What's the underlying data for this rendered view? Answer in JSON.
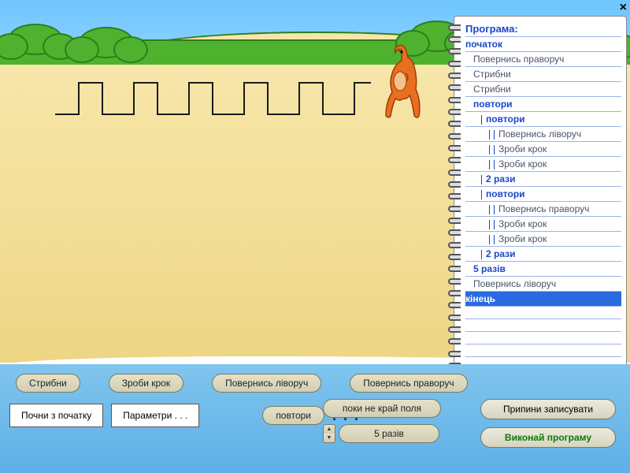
{
  "close_label": "×",
  "buttons": {
    "jump": "Стрибни",
    "step": "Зроби крок",
    "turn_left": "Повернись ліворуч",
    "turn_right": "Повернись праворуч",
    "start_over": "Почни з початку",
    "params": "Параметри . . .",
    "repeat": "повтори",
    "while_not_edge": "поки не край поля",
    "times_5": "5 разів",
    "stop_record": "Припини записувати",
    "run": "Виконай програму"
  },
  "ellipsis": ". . .",
  "program": {
    "title": "Програма:",
    "lines": [
      {
        "text": "початок",
        "cls": "kw",
        "indent": 0
      },
      {
        "text": "Повернись праворуч",
        "cls": "cmd",
        "indent": 1
      },
      {
        "text": "Стрибни",
        "cls": "cmd",
        "indent": 1
      },
      {
        "text": "Стрибни",
        "cls": "cmd",
        "indent": 1
      },
      {
        "text": "повтори",
        "cls": "kw",
        "indent": 1
      },
      {
        "text": "повтори",
        "cls": "kw",
        "indent": 2,
        "bars": 1
      },
      {
        "text": "Повернись ліворуч",
        "cls": "cmd",
        "indent": 3,
        "bars": 2
      },
      {
        "text": "Зроби крок",
        "cls": "cmd",
        "indent": 3,
        "bars": 2
      },
      {
        "text": "Зроби крок",
        "cls": "cmd",
        "indent": 3,
        "bars": 2
      },
      {
        "text": "2 рази",
        "cls": "kw",
        "indent": 2,
        "bars": 1
      },
      {
        "text": "повтори",
        "cls": "kw",
        "indent": 2,
        "bars": 1
      },
      {
        "text": "Повернись праворуч",
        "cls": "cmd",
        "indent": 3,
        "bars": 2
      },
      {
        "text": "Зроби крок",
        "cls": "cmd",
        "indent": 3,
        "bars": 2
      },
      {
        "text": "Зроби крок",
        "cls": "cmd",
        "indent": 3,
        "bars": 2
      },
      {
        "text": "2 рази",
        "cls": "kw",
        "indent": 2,
        "bars": 1
      },
      {
        "text": "5 разів",
        "cls": "kw",
        "indent": 1
      },
      {
        "text": "Повернись ліворуч",
        "cls": "cmd",
        "indent": 1
      },
      {
        "text": "кінець",
        "cls": "kw sel",
        "indent": 0
      }
    ]
  },
  "stepper": {
    "up": "▲",
    "down": "▼"
  }
}
